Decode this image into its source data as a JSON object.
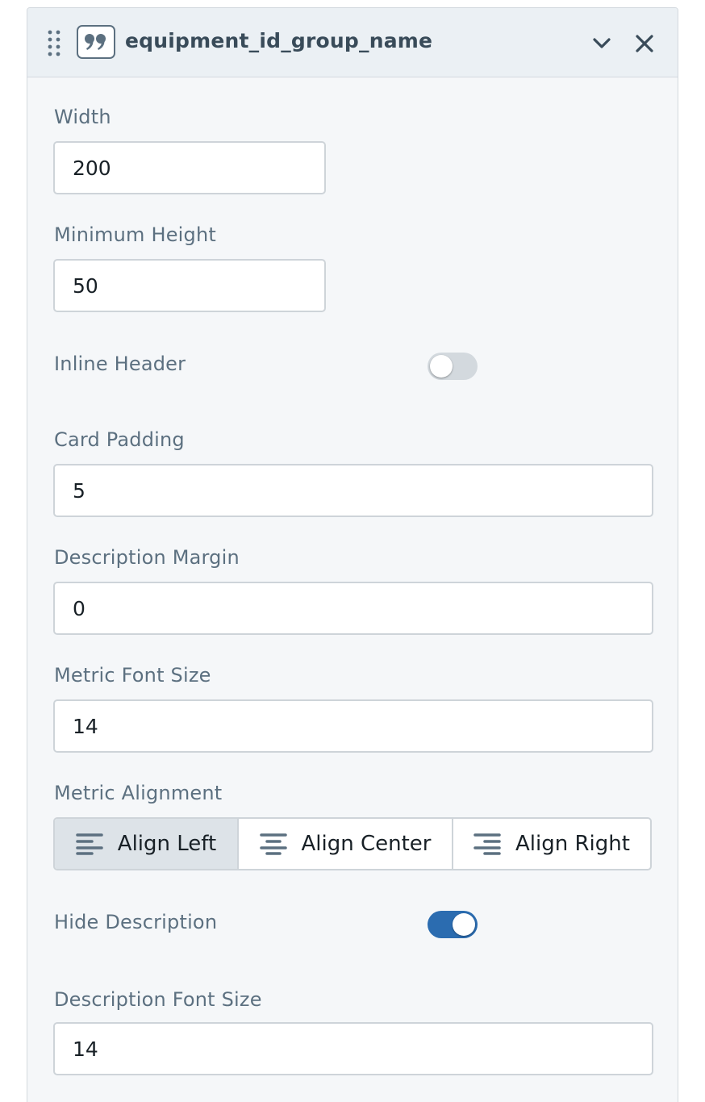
{
  "panel": {
    "title": "equipment_id_group_name",
    "icons": {
      "drag": "drag-handle-icon",
      "type": "quote-icon",
      "collapse": "chevron-down-icon",
      "close": "close-icon"
    }
  },
  "fields": {
    "width": {
      "label": "Width",
      "value": "200"
    },
    "min_height": {
      "label": "Minimum Height",
      "value": "50"
    },
    "card_padding": {
      "label": "Card Padding",
      "value": "5"
    },
    "description_margin": {
      "label": "Description Margin",
      "value": "0"
    },
    "metric_font_size": {
      "label": "Metric Font Size",
      "value": "14"
    },
    "description_font_size": {
      "label": "Description Font Size",
      "value": "14"
    }
  },
  "toggles": {
    "inline_header": {
      "label": "Inline Header",
      "checked": false
    },
    "hide_description": {
      "label": "Hide Description",
      "checked": true
    }
  },
  "alignment": {
    "label": "Metric Alignment",
    "options": [
      "Align Left",
      "Align Center",
      "Align Right"
    ],
    "selected": "Align Left"
  },
  "colors": {
    "accent": "#2b6cb0",
    "label_text": "#5c7080",
    "header_bg": "#ebf0f4",
    "panel_bg": "#f5f7f9"
  }
}
